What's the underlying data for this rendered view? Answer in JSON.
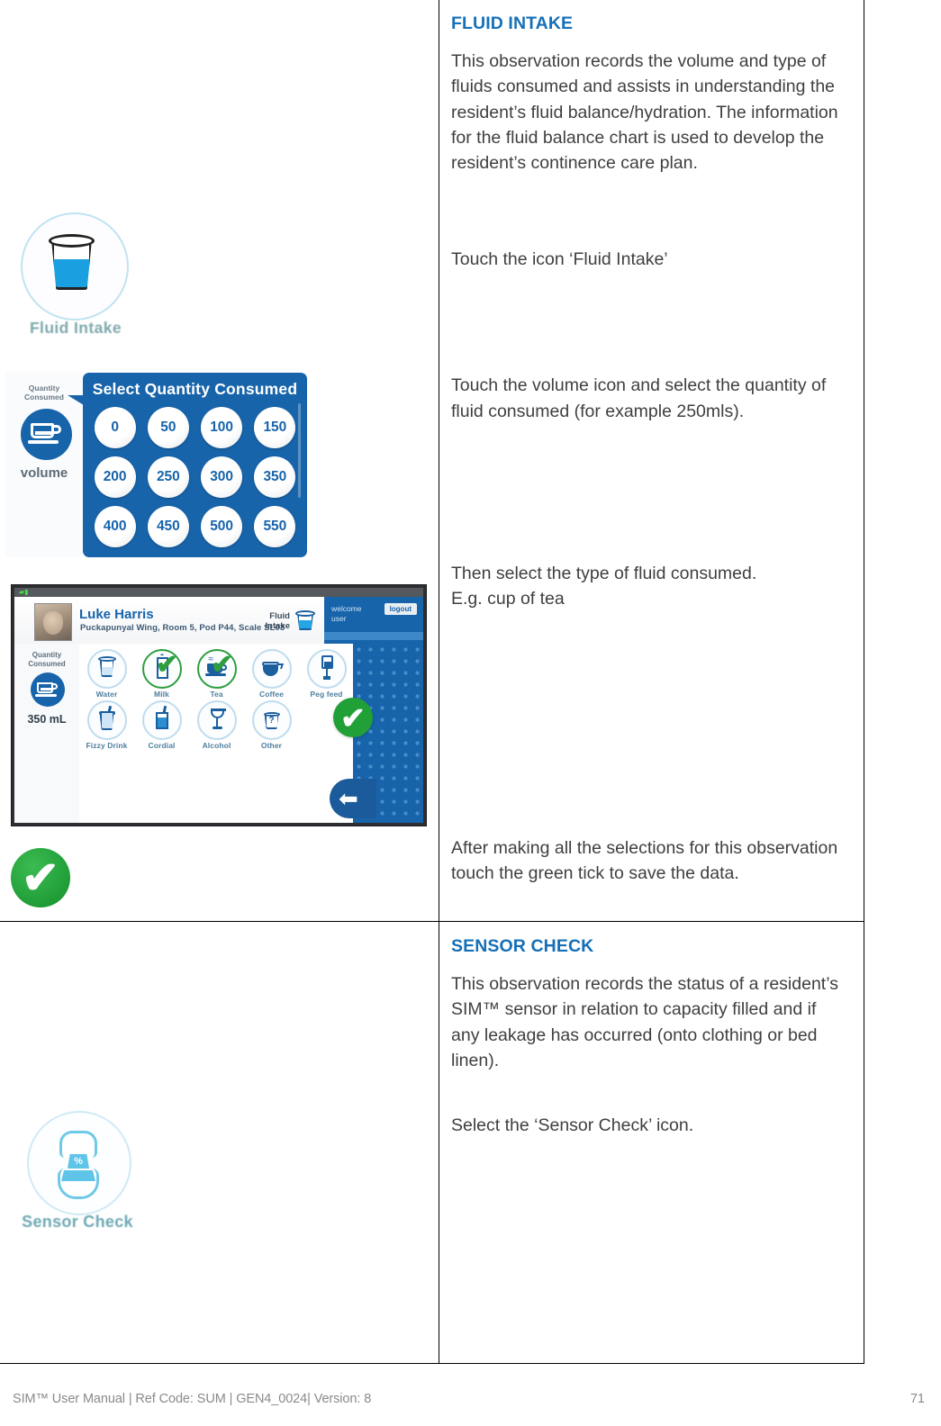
{
  "document": {
    "footer_text": "SIM™ User Manual | Ref Code: SUM | GEN4_0024| Version: 8",
    "page_number": "71",
    "accent_color": "#1570b8",
    "brand_blue": "#1764ab",
    "tick_green": "#21a038"
  },
  "sections": [
    {
      "id": "fluid-intake",
      "title": "FLUID INTAKE",
      "intro": "This observation records the volume and type of fluids consumed and assists in understanding the resident’s fluid balance/hydration. The information for the fluid balance chart is used to develop the resident’s continence care plan.",
      "step1": "Touch the icon ‘Fluid Intake’",
      "step2": "Touch the volume icon and select the quantity of fluid consumed (for example 250mls).",
      "step3a": "Then select the type of fluid consumed.",
      "step3b": "E.g. cup of tea",
      "step4": "After making all the selections for this observation touch the green tick to save the data."
    },
    {
      "id": "sensor-check",
      "title": "SENSOR CHECK",
      "intro": "This observation records the status of a resident’s SIM™ sensor in relation to capacity filled and if any leakage has occurred (onto clothing or bed linen).",
      "step1": "Select the ‘Sensor Check’ icon."
    }
  ],
  "fluid_icon": {
    "caption": "Fluid Intake",
    "icon_name": "fluid-intake-cup-icon"
  },
  "sensor_icon": {
    "caption": "Sensor Check",
    "percent_label": "%",
    "icon_name": "sensor-pad-icon"
  },
  "quantity_panel": {
    "side_label": "Quantity\nConsumed",
    "side_label_line1": "Quantity",
    "side_label_line2": "Consumed",
    "volume_label": "volume",
    "title": "Select Quantity Consumed",
    "options": [
      "0",
      "50",
      "100",
      "150",
      "200",
      "250",
      "300",
      "350",
      "400",
      "450",
      "500",
      "550"
    ]
  },
  "tablet": {
    "resident_name": "Luke Harris",
    "resident_details": "Puckapunyal Wing, Room 5, Pod P44, Scale SL03",
    "observation_label_line1": "Fluid",
    "observation_label_line2": "Intake",
    "welcome_line1": "welcome",
    "welcome_line2": "user",
    "logout_label": "logout",
    "quantity_label_line1": "Quantity",
    "quantity_label_line2": "Consumed",
    "quantity_value": "350 mL",
    "fluid_types_row1": [
      {
        "label": "Water",
        "selected": false,
        "glyph": "glass"
      },
      {
        "label": "Milk",
        "selected": true,
        "glyph": "carton"
      },
      {
        "label": "Tea",
        "selected": true,
        "glyph": "cup"
      },
      {
        "label": "Coffee",
        "selected": false,
        "glyph": "pot"
      },
      {
        "label": "Peg feed",
        "selected": false,
        "glyph": "peg"
      }
    ],
    "fluid_types_row2": [
      {
        "label": "Fizzy Drink",
        "selected": false,
        "glyph": "fizzy"
      },
      {
        "label": "Cordial",
        "selected": false,
        "glyph": "cordial"
      },
      {
        "label": "Alcohol",
        "selected": false,
        "glyph": "wine"
      },
      {
        "label": "Other",
        "selected": false,
        "glyph": "other"
      }
    ],
    "save_tick": "✔",
    "back_arrow": "⬅"
  },
  "big_tick": {
    "glyph": "✔"
  }
}
